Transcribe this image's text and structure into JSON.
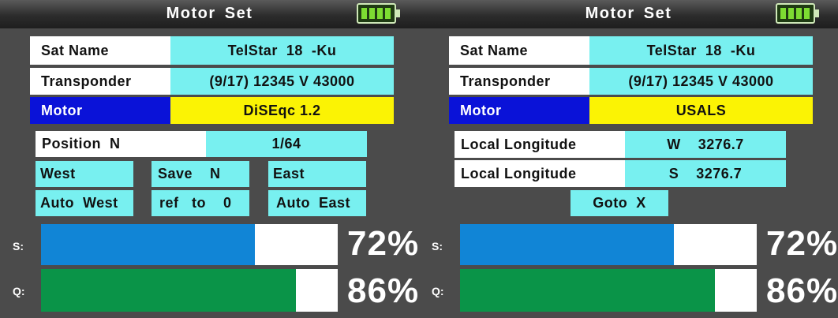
{
  "left": {
    "title": "Motor Set",
    "sat_name_label": "Sat Name",
    "sat_name_value": "TelStar  18  -Ku",
    "transponder_label": "Transponder",
    "transponder_value": "(9/17) 12345 V 43000",
    "motor_label": "Motor",
    "motor_value": "DiSEqc 1.2",
    "position_label": "Position  N",
    "position_value": "1/64",
    "west_button": "West",
    "save_button": "Save    N",
    "east_button": "East",
    "auto_west_button": "Auto  West",
    "ref_button": "ref   to    0",
    "auto_east_button": "Auto  East",
    "signal_label": "S:",
    "signal_percent": 72,
    "signal_text": "72%",
    "quality_label": "Q:",
    "quality_percent": 86,
    "quality_text": "86%"
  },
  "right": {
    "title": "Motor Set",
    "sat_name_label": "Sat Name",
    "sat_name_value": "TelStar  18  -Ku",
    "transponder_label": "Transponder",
    "transponder_value": "(9/17) 12345 V 43000",
    "motor_label": "Motor",
    "motor_value": "USALS",
    "longitude_label": "Local Longitude",
    "longitude_value": "W    3276.7",
    "latitude_label": "Local Longitude",
    "latitude_value": "S    3276.7",
    "goto_button": "Goto  X",
    "signal_label": "S:",
    "signal_percent": 72,
    "signal_text": "72%",
    "quality_label": "Q:",
    "quality_percent": 86,
    "quality_text": "86%"
  },
  "colors": {
    "signal_fill": "#1185d6",
    "quality_fill": "#0a9448",
    "battery_icon": "battery-full-icon"
  }
}
